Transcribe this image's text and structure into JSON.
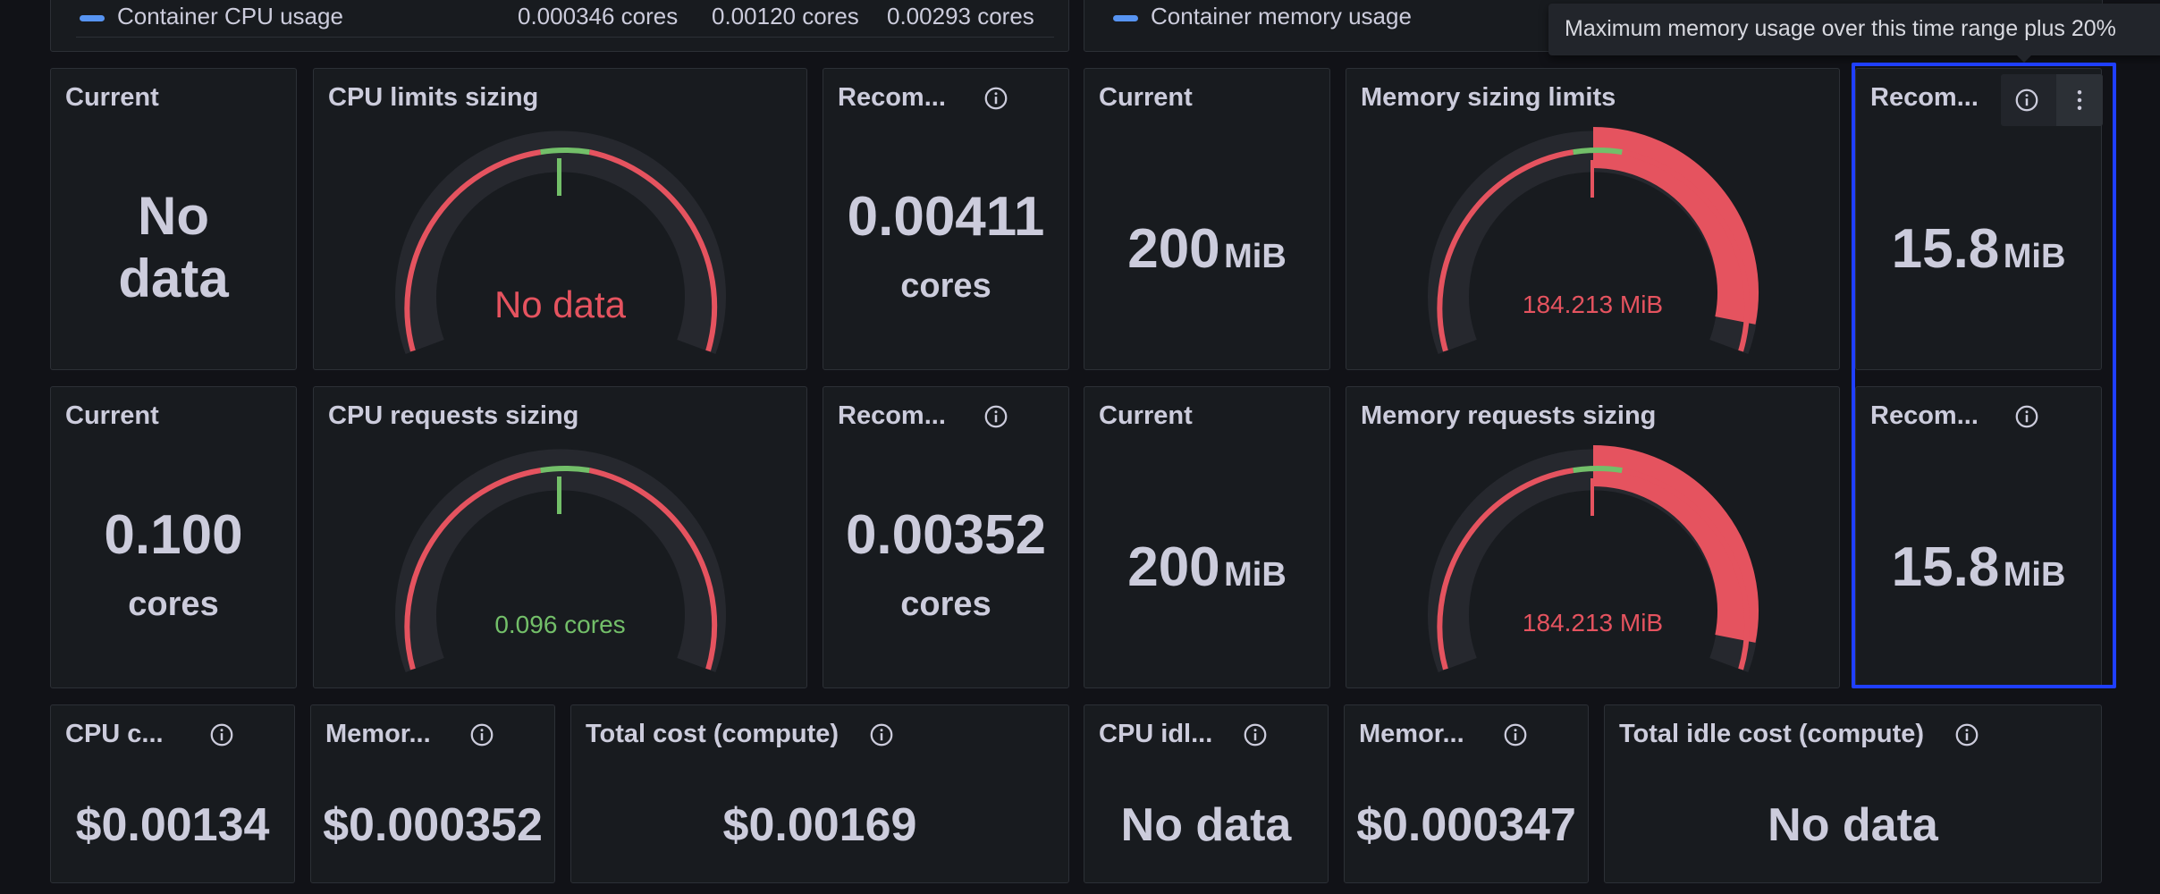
{
  "colors": {
    "accent_blue": "#5794f2",
    "red": "#e5535f",
    "green": "#73bf69",
    "selection": "#1f3fff"
  },
  "legend_cpu": {
    "label": "Container CPU usage",
    "v1": "0.000346 cores",
    "v2": "0.00120 cores",
    "v3": "0.00293 cores"
  },
  "legend_mem": {
    "label": "Container memory usage"
  },
  "tooltip": "Maximum memory usage over this time range plus 20%",
  "row1": {
    "cpu_current": {
      "title": "Current",
      "value": "No data"
    },
    "cpu_limits": {
      "title": "CPU limits sizing",
      "value": "No data"
    },
    "cpu_rec": {
      "title": "Recom...",
      "value": "0.00411",
      "unit": "cores"
    },
    "mem_current": {
      "title": "Current",
      "value": "200",
      "unit": "MiB"
    },
    "mem_limits": {
      "title": "Memory sizing limits",
      "value": "184.213 MiB"
    },
    "mem_rec": {
      "title": "Recom...",
      "value": "15.8",
      "unit": "MiB"
    }
  },
  "row2": {
    "cpu_current": {
      "title": "Current",
      "value": "0.100",
      "unit": "cores"
    },
    "cpu_requests": {
      "title": "CPU requests sizing",
      "value": "0.096 cores"
    },
    "cpu_rec": {
      "title": "Recom...",
      "value": "0.00352",
      "unit": "cores"
    },
    "mem_current": {
      "title": "Current",
      "value": "200",
      "unit": "MiB"
    },
    "mem_requests": {
      "title": "Memory requests sizing",
      "value": "184.213 MiB"
    },
    "mem_rec": {
      "title": "Recom...",
      "value": "15.8",
      "unit": "MiB"
    }
  },
  "row3": {
    "cpu_cost": {
      "title": "CPU c...",
      "value": "$0.00134"
    },
    "mem_cost": {
      "title": "Memor...",
      "value": "$0.000352"
    },
    "total_cost": {
      "title": "Total cost (compute)",
      "value": "$0.00169"
    },
    "cpu_idle": {
      "title": "CPU idl...",
      "value": "No data"
    },
    "mem_idle": {
      "title": "Memor...",
      "value": "$0.000347"
    },
    "total_idle": {
      "title": "Total idle cost (compute)",
      "value": "No data"
    }
  },
  "gauges": {
    "mem_limits_fill": 0.92,
    "mem_requests_fill": 0.92,
    "cpu_requests_fill": 0.96
  }
}
